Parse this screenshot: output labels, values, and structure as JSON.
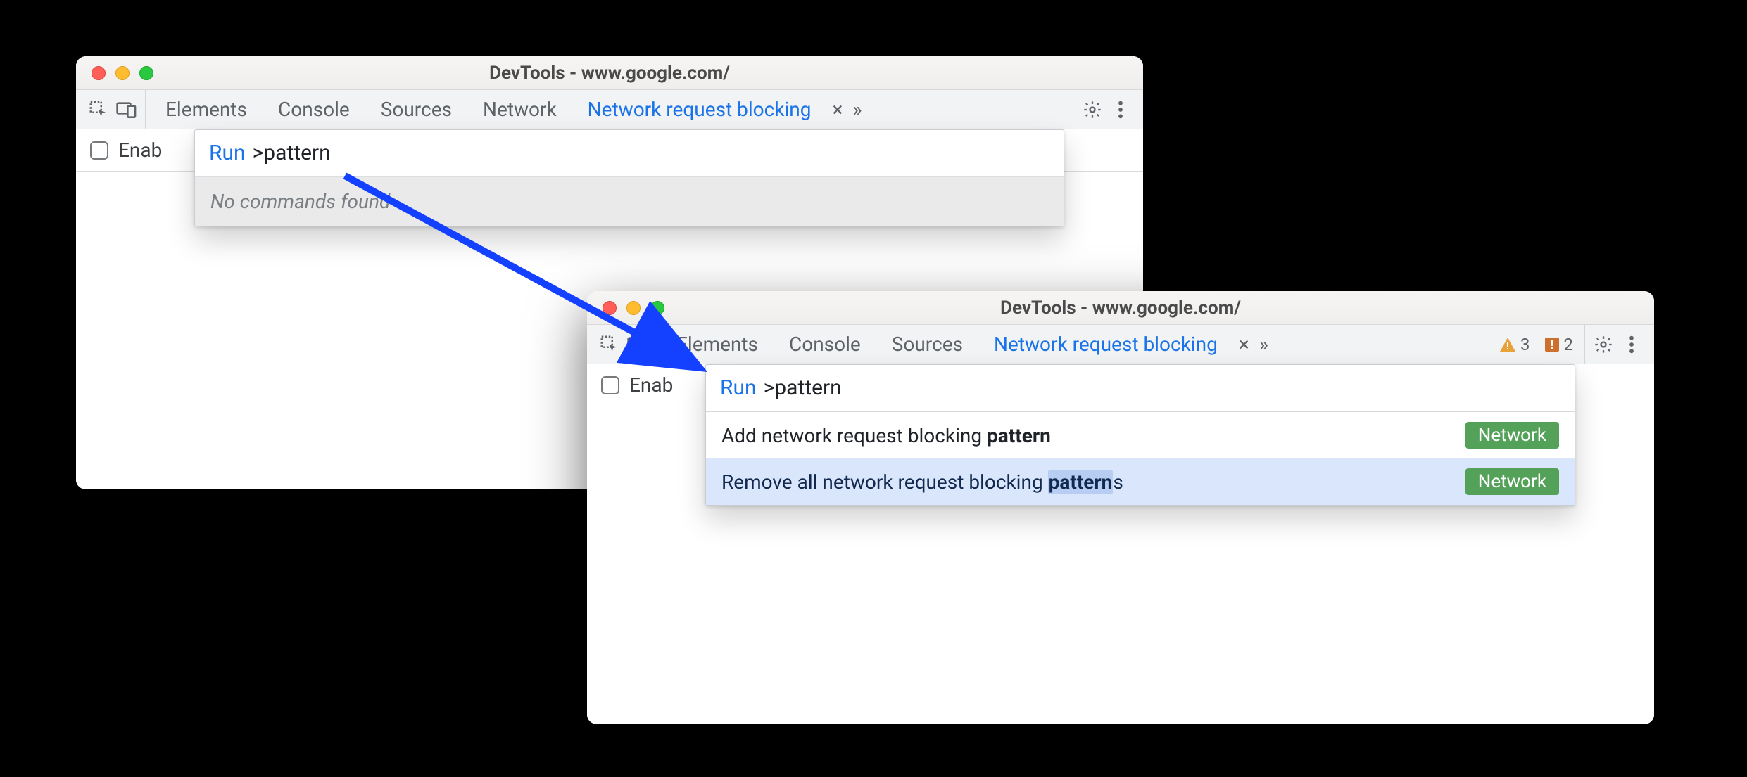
{
  "windowA": {
    "title": "DevTools - www.google.com/",
    "tabs": {
      "elements": "Elements",
      "console": "Console",
      "sources": "Sources",
      "network": "Network",
      "blocking": "Network request blocking"
    },
    "enable_label": "Enab",
    "command": {
      "run": "Run",
      "input": ">pattern",
      "empty": "No commands found"
    }
  },
  "windowB": {
    "title": "DevTools - www.google.com/",
    "tabs": {
      "elements": "Elements",
      "console": "Console",
      "sources": "Sources",
      "blocking": "Network request blocking"
    },
    "warnings_count": "3",
    "issues_count": "2",
    "enable_label": "Enab",
    "command": {
      "run": "Run",
      "input": ">pattern",
      "items": [
        {
          "pre": "Add network request blocking ",
          "match": "pattern",
          "post": "",
          "badge": "Network"
        },
        {
          "pre": "Remove all network request blocking ",
          "match": "pattern",
          "post": "s",
          "badge": "Network"
        }
      ]
    }
  }
}
